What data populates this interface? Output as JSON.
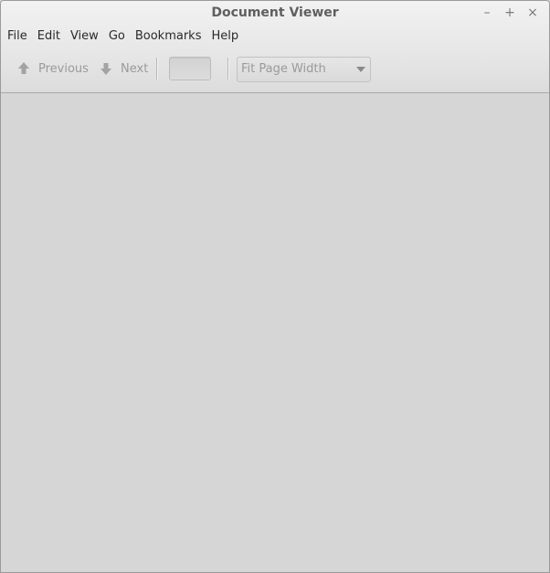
{
  "window": {
    "title": "Document Viewer",
    "controls": {
      "minimize": "–",
      "maximize": "+",
      "close": "×"
    }
  },
  "menubar": {
    "items": [
      {
        "label": "File"
      },
      {
        "label": "Edit"
      },
      {
        "label": "View"
      },
      {
        "label": "Go"
      },
      {
        "label": "Bookmarks"
      },
      {
        "label": "Help"
      }
    ]
  },
  "toolbar": {
    "previous": {
      "label": "Previous",
      "icon": "arrow-up-icon",
      "enabled": false
    },
    "next": {
      "label": "Next",
      "icon": "arrow-down-icon",
      "enabled": false
    },
    "page_entry": {
      "value": ""
    },
    "zoom": {
      "selected": "Fit Page Width"
    }
  },
  "colors": {
    "chrome_top": "#f2f2f2",
    "chrome_bottom": "#dcdcdc",
    "content_bg": "#d6d6d6",
    "disabled_text": "#9a9a9a",
    "title_text": "#5f5f5f"
  }
}
